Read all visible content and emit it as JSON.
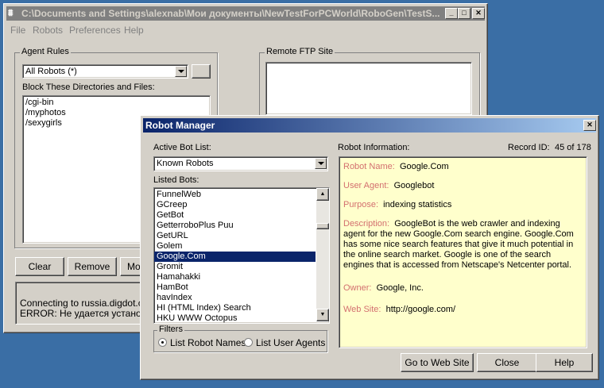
{
  "main_window": {
    "title": "C:\\Documents and Settings\\alexnab\\Мои документы\\NewTestForPCWorld\\RoboGen\\TestS...",
    "menu": [
      "File",
      "Robots",
      "Preferences",
      "Help"
    ],
    "agent_rules_label": "Agent Rules",
    "agent_select_value": "All Robots  (*)",
    "block_label": "Block These Directories and Files:",
    "blocked_paths": [
      "/cgi-bin",
      "/myphotos",
      "/sexygirls"
    ],
    "remote_ftp_label": "Remote FTP Site",
    "buttons": {
      "clear": "Clear",
      "remove": "Remove",
      "modify": "Moc"
    },
    "status_lines": [
      "Connecting to russia.digdot.com",
      "ERROR: Не удается установи"
    ]
  },
  "dialog": {
    "title": "Robot Manager",
    "active_bot_list_label": "Active Bot List:",
    "active_bot_list_value": "Known Robots",
    "listed_bots_label": "Listed Bots:",
    "bots": [
      "FunnelWeb",
      "GCreep",
      "GetBot",
      "GetterroboPlus Puu",
      "GetURL",
      "Golem",
      "Google.Com",
      "Gromit",
      "Hamahakki",
      "HamBot",
      "havIndex",
      "HI (HTML Index) Search",
      "HKU WWW Octopus"
    ],
    "selected_bot": "Google.Com",
    "filters_label": "Filters",
    "filter_robot_names": "List Robot Names",
    "filter_user_agents": "List User Agents",
    "robot_info_label": "Robot Information:",
    "record_id_label": "Record ID:",
    "record_id_value": "45 of 178",
    "info": {
      "robot_name_label": "Robot Name:",
      "robot_name": "Google.Com",
      "user_agent_label": "User Agent:",
      "user_agent": "Googlebot",
      "purpose_label": "Purpose:",
      "purpose": "indexing statistics",
      "description_label": "Description:",
      "description": "GoogleBot is the web crawler and indexing agent for the new Google.Com search engine.  Google.Com has some nice search features that give it much potential in the online search market.  Google is one of the search engines that is accessed from Netscape's Netcenter portal.",
      "owner_label": "Owner:",
      "owner": "Google, Inc.",
      "web_site_label": "Web Site:",
      "web_site": "http://google.com/"
    },
    "buttons": {
      "go_to_web_site": "Go to Web Site",
      "close": "Close",
      "help": "Help"
    }
  },
  "colors": {
    "desktop": "#3a6ea5",
    "title_active": "#0a246a",
    "title_inactive": "#808080",
    "info_bg": "#ffffcc",
    "info_label": "#d36f6f"
  }
}
